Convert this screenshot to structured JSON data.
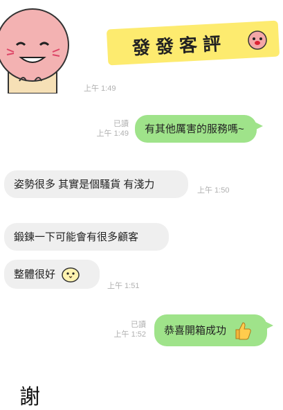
{
  "sticker": {
    "text": "發發客評"
  },
  "messages": [
    {
      "id": "m1",
      "side": "out",
      "text": "有其他厲害的服務嗎~",
      "read": "已讀",
      "time": "上午 1:49"
    },
    {
      "id": "m2",
      "side": "in",
      "text": "姿勢很多 其實是個騷貨 有淺力",
      "time": "上午 1:50"
    },
    {
      "id": "m3",
      "side": "in",
      "text": "鍛鍊一下可能會有很多顧客"
    },
    {
      "id": "m4",
      "side": "in",
      "text": "整體很好",
      "time": "上午 1:51"
    },
    {
      "id": "m5",
      "side": "out",
      "text": "恭喜開箱成功",
      "read": "已讀",
      "time": "上午 1:52"
    }
  ],
  "avatar_time": "上午 1:49",
  "footer_handwriting": "謝",
  "colors": {
    "outgoing": "#9fe38a",
    "incoming": "#efefef",
    "sticker_band": "#fdeb6f"
  }
}
